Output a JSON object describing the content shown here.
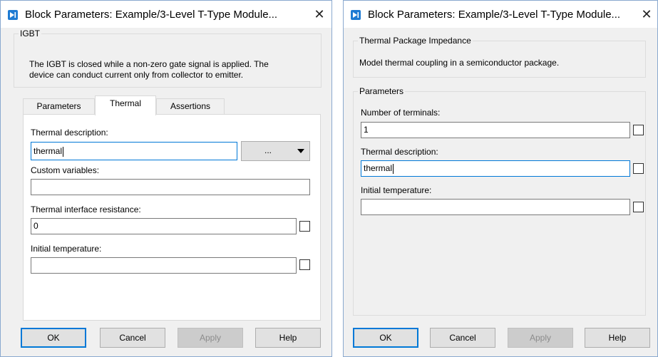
{
  "dialog1": {
    "title": "Block Parameters: Example/3-Level T-Type Module...",
    "group_label": "IGBT",
    "description": [
      "The IGBT is closed while a non-zero gate signal is applied. The",
      "device can conduct current only from collector to emitter."
    ],
    "tabs": [
      {
        "label": "Parameters",
        "active": false
      },
      {
        "label": "Thermal",
        "active": true
      },
      {
        "label": "Assertions",
        "active": false
      }
    ],
    "fields": {
      "thermal_description": {
        "label": "Thermal description:",
        "value": "thermal"
      },
      "dropdown_button_label": "...",
      "custom_variables": {
        "label": "Custom variables:",
        "value": ""
      },
      "thermal_interface_resistance": {
        "label": "Thermal interface resistance:",
        "value": "0",
        "checked": false
      },
      "initial_temperature": {
        "label": "Initial temperature:",
        "value": "",
        "checked": false
      }
    },
    "buttons": {
      "ok": "OK",
      "cancel": "Cancel",
      "apply": "Apply",
      "help": "Help"
    }
  },
  "dialog2": {
    "title": "Block Parameters: Example/3-Level T-Type Module...",
    "group_label": "Thermal Package Impedance",
    "description": "Model thermal coupling in a semiconductor package.",
    "params_label": "Parameters",
    "fields": {
      "number_of_terminals": {
        "label": "Number of terminals:",
        "value": "1",
        "checked": false
      },
      "thermal_description": {
        "label": "Thermal description:",
        "value": "thermal",
        "checked": false
      },
      "initial_temperature": {
        "label": "Initial temperature:",
        "value": "",
        "checked": false
      }
    },
    "buttons": {
      "ok": "OK",
      "cancel": "Cancel",
      "apply": "Apply",
      "help": "Help"
    }
  },
  "icons": {
    "app": "simulink-block-icon",
    "close": "close-icon",
    "dropdown": "chevron-down-icon"
  },
  "colors": {
    "accent": "#0078d7",
    "app_icon": "#1e7bd3",
    "dialog_bg": "#f0f0f0",
    "disabled_text": "#8c8c8c"
  }
}
